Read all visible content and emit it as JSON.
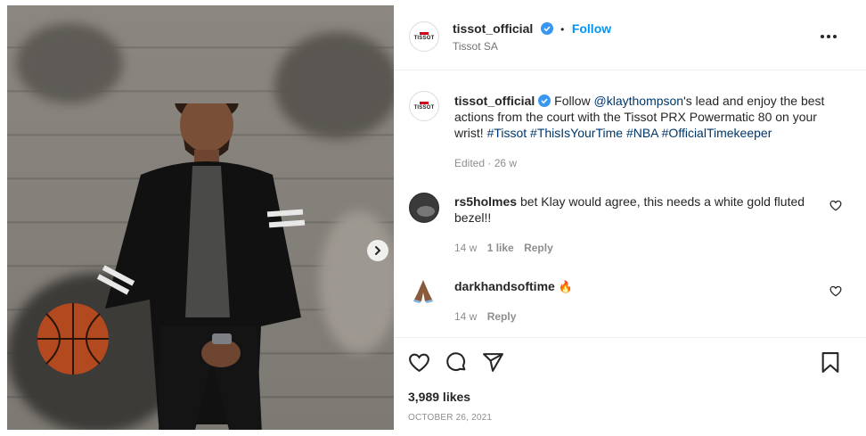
{
  "post": {
    "username": "tissot_official",
    "separator": "•",
    "follow_label": "Follow",
    "location": "Tissot SA",
    "more_icon": "more-horizontal-icon"
  },
  "caption": {
    "username": "tissot_official",
    "text_pre": "Follow ",
    "mention": "@klaythompson",
    "text_mid": "'s lead and enjoy the best actions from the court with the Tissot PRX Powermatic 80 on your wrist! ",
    "hashtags": "#Tissot #ThisIsYourTime #NBA #OfficialTimekeeper",
    "meta": "Edited · 26 w"
  },
  "comments": [
    {
      "username": "rs5holmes",
      "text": "bet Klay would agree, this needs a white gold fluted bezel!!",
      "time": "14 w",
      "likes": "1 like",
      "reply": "Reply"
    },
    {
      "username": "darkhandsoftime",
      "text": "🔥",
      "time": "14 w",
      "reply": "Reply"
    }
  ],
  "actions": {
    "likes": "3,989 likes",
    "date": "OCTOBER 26, 2021"
  },
  "colors": {
    "accent": "#0095f6",
    "verified": "#3897f0"
  }
}
